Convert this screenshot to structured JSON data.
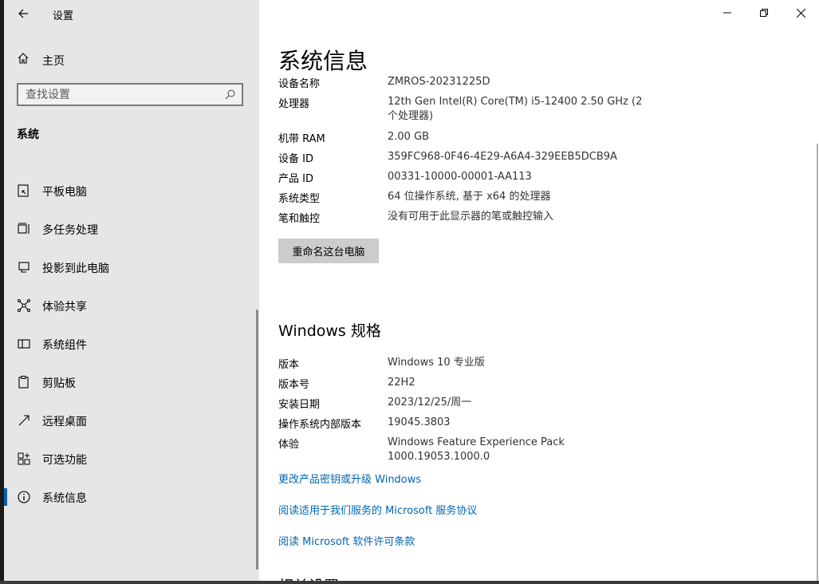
{
  "app": {
    "title": "设置"
  },
  "nav": {
    "home": "主页",
    "search_placeholder": "查找设置",
    "section": "系统",
    "items": [
      {
        "label": "平板电脑",
        "icon": "tablet-icon"
      },
      {
        "label": "多任务处理",
        "icon": "multitasking-icon"
      },
      {
        "label": "投影到此电脑",
        "icon": "project-icon"
      },
      {
        "label": "体验共享",
        "icon": "shared-experience-icon"
      },
      {
        "label": "系统组件",
        "icon": "components-icon"
      },
      {
        "label": "剪贴板",
        "icon": "clipboard-icon"
      },
      {
        "label": "远程桌面",
        "icon": "remote-desktop-icon"
      },
      {
        "label": "可选功能",
        "icon": "optional-features-icon"
      },
      {
        "label": "系统信息",
        "icon": "info-icon",
        "active": true
      }
    ]
  },
  "page": {
    "title": "系统信息",
    "device": [
      {
        "key": "设备名称",
        "value": "ZMROS-20231225D"
      },
      {
        "key": "处理器",
        "value": "12th Gen Intel(R) Core(TM) i5-12400   2.50 GHz  (2 个处理器)"
      },
      {
        "key": "机带 RAM",
        "value": "2.00 GB"
      },
      {
        "key": "设备 ID",
        "value": "359FC968-0F46-4E29-A6A4-329EEB5DCB9A"
      },
      {
        "key": "产品 ID",
        "value": "00331-10000-00001-AA113"
      },
      {
        "key": "系统类型",
        "value": "64 位操作系统, 基于 x64 的处理器"
      },
      {
        "key": "笔和触控",
        "value": "没有可用于此显示器的笔或触控输入"
      }
    ],
    "rename_button": "重命名这台电脑",
    "spec_title": "Windows 规格",
    "spec": [
      {
        "key": "版本",
        "value": "Windows 10 专业版"
      },
      {
        "key": "版本号",
        "value": "22H2"
      },
      {
        "key": "安装日期",
        "value": "2023/12/25/周一"
      },
      {
        "key": "操作系统内部版本",
        "value": "19045.3803"
      },
      {
        "key": "体验",
        "value": "Windows Feature Experience Pack 1000.19053.1000.0"
      }
    ],
    "links": [
      "更改产品密钥或升级 Windows",
      "阅读适用于我们服务的 Microsoft 服务协议",
      "阅读 Microsoft 软件许可条款"
    ],
    "next_section": "相关设置"
  },
  "colors": {
    "accent": "#0063b1",
    "link": "#0066b4",
    "sidebar_bg": "#e6e6e6",
    "button_bg": "#cccccc"
  }
}
